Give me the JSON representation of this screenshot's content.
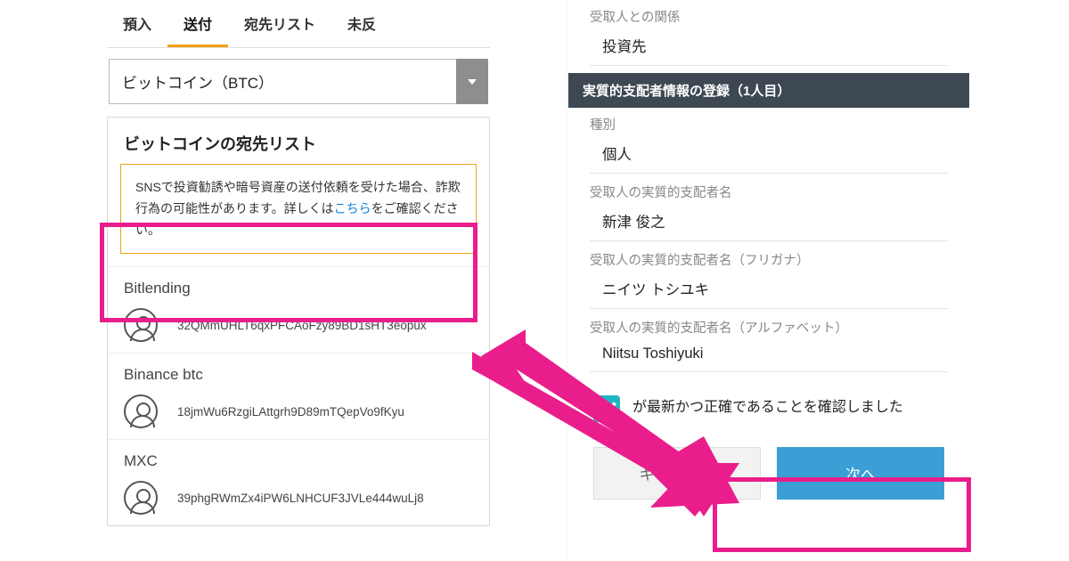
{
  "left": {
    "tabs": [
      "預入",
      "送付",
      "宛先リスト",
      "未反"
    ],
    "active_tab_index": 1,
    "select_value": "ビットコイン（BTC）",
    "card_title": "ビットコインの宛先リスト",
    "alert_pre": "SNSで投資勧誘や暗号資産の送付依頼を受けた場合、詐欺行為の可能性があります。詳しくは",
    "alert_link": "こちら",
    "alert_post": "をご確認ください。",
    "addresses": [
      {
        "name": "Bitlending",
        "addr": "32QMmUHLT6qxPFCAoFzy89BD1sHT3eopux"
      },
      {
        "name": "Binance btc",
        "addr": "18jmWu6RzgiLAttgrh9D89mTQepVo9fKyu"
      },
      {
        "name": "MXC",
        "addr": "39phgRWmZx4iPW6LNHCUF3JVLe444wuLj8"
      }
    ]
  },
  "right": {
    "rel_label": "受取人との関係",
    "rel_value": "投資先",
    "section_title": "実質的支配者情報の登録（1人目）",
    "type_label": "種別",
    "type_value": "個人",
    "name_label": "受取人の実質的支配者名",
    "name_value": "新津 俊之",
    "kana_label": "受取人の実質的支配者名（フリガナ）",
    "kana_value": "ニイツ トシユキ",
    "alpha_label": "受取人の実質的支配者名（アルファベット）",
    "alpha_value": "Niitsu Toshiyuki",
    "confirm_text_partial": "が最新かつ正確であることを確認しました",
    "cancel_label": "キャンセル",
    "next_label": "次へ"
  },
  "colors": {
    "accent_orange": "#f2a215",
    "highlight_pink": "#e91e8c",
    "button_blue": "#3b9fd6",
    "check_teal": "#1fb6c1",
    "section_bg": "#3d4852"
  }
}
